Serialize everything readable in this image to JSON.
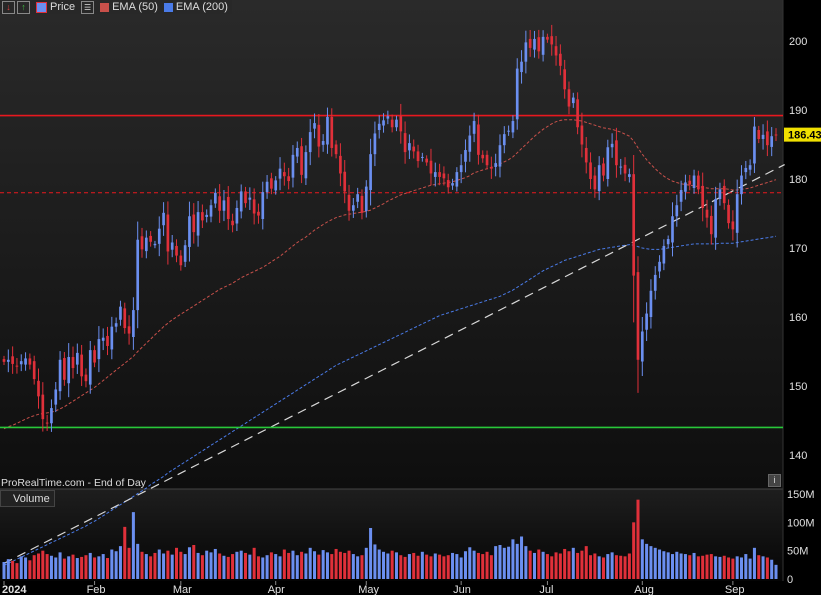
{
  "legend": {
    "price_label": "Price",
    "ema50_label": "EMA (50)",
    "ema200_label": "EMA (200)"
  },
  "volume_label": "Volume",
  "watermark": "ProRealTime.com - End of Day",
  "info_icon": "info-icon",
  "colors": {
    "background": "#000000",
    "up_candle": "#6b8ff0",
    "down_candle": "#e0303a",
    "ema50": "#c8504a",
    "ema200": "#4a7be8",
    "resistance": "#e8181f",
    "support": "#28c83a",
    "trendline": "#d8d8d8",
    "last_price_badge": "#f0e000"
  },
  "chart_data": [
    {
      "type": "candlestick",
      "title": "",
      "ylim": [
        135,
        205
      ],
      "y_ticks": [
        140,
        150,
        160,
        170,
        180,
        190,
        200
      ],
      "x_tick_labels": [
        "2024",
        "Feb",
        "Mar",
        "Apr",
        "May",
        "Jun",
        "Jul",
        "Aug",
        "Sep"
      ],
      "last_price": "186.43",
      "horizontal_levels": [
        {
          "name": "resistance",
          "y": 189.2,
          "style": "solid",
          "color": "#e8181f"
        },
        {
          "name": "mid-level",
          "y": 178.0,
          "style": "dashed",
          "color": "#e8181f"
        },
        {
          "name": "support",
          "y": 144.0,
          "style": "solid",
          "color": "#28c83a"
        }
      ],
      "trendline": {
        "style": "dashed",
        "from": [
          "2024-01-31",
          131.0
        ],
        "to": [
          "2024-09-12",
          180.5
        ]
      },
      "close": [
        153.5,
        153.8,
        153.2,
        152.9,
        153.6,
        154.0,
        153.1,
        151.0,
        148.5,
        145.2,
        144.6,
        146.8,
        149.5,
        153.8,
        150.9,
        154.2,
        152.6,
        154.8,
        151.4,
        150.7,
        155.2,
        153.4,
        156.8,
        157.0,
        155.8,
        158.6,
        159.1,
        161.5,
        158.4,
        157.6,
        161.0,
        171.2,
        169.8,
        171.5,
        170.9,
        170.6,
        172.8,
        175.1,
        169.5,
        170.8,
        168.9,
        167.5,
        170.4,
        174.6,
        172.3,
        175.2,
        174.0,
        174.8,
        176.2,
        178.0,
        175.4,
        176.9,
        174.2,
        173.3,
        175.8,
        178.2,
        176.5,
        177.3,
        175.0,
        174.7,
        178.1,
        179.6,
        178.6,
        179.8,
        181.5,
        180.4,
        179.7,
        183.5,
        184.5,
        180.6,
        183.9,
        186.8,
        188.1,
        184.7,
        185.5,
        189.0,
        184.5,
        183.6,
        180.8,
        178.2,
        175.4,
        176.2,
        177.8,
        175.1,
        178.9,
        183.6,
        186.6,
        188.0,
        188.5,
        189.1,
        187.5,
        188.6,
        186.9,
        183.9,
        185.2,
        184.0,
        182.6,
        183.2,
        182.4,
        180.8,
        181.0,
        180.3,
        180.1,
        178.8,
        179.4,
        181.0,
        182.0,
        184.2,
        186.3,
        188.4,
        183.5,
        183.0,
        182.0,
        181.5,
        182.3,
        184.9,
        186.5,
        187.0,
        188.4,
        196.0,
        197.0,
        199.8,
        199.0,
        200.3,
        198.5,
        200.6,
        200.2,
        199.5,
        197.9,
        196.4,
        193.0,
        190.5,
        191.8,
        187.5,
        185.0,
        182.4,
        180.0,
        178.5,
        182.0,
        180.5,
        184.6,
        185.1,
        182.0,
        181.8,
        180.8,
        180.7,
        166.0,
        153.8,
        157.9,
        160.5,
        163.8,
        166.1,
        168.0,
        170.3,
        171.3,
        174.6,
        176.2,
        178.4,
        179.5,
        179.2,
        180.5,
        178.5,
        175.8,
        174.4,
        172.0,
        177.1,
        178.5,
        176.5,
        173.6,
        172.7,
        177.8,
        180.5,
        181.6,
        182.0,
        187.6,
        185.8,
        186.4,
        184.9,
        186.2,
        186.43
      ],
      "ema50": [
        143.8,
        144.1,
        144.3,
        144.6,
        144.9,
        145.2,
        145.5,
        145.7,
        145.9,
        146.0,
        146.1,
        146.2,
        146.4,
        146.7,
        147.0,
        147.4,
        147.8,
        148.2,
        148.6,
        149.0,
        149.4,
        149.8,
        150.3,
        150.8,
        151.3,
        151.8,
        152.3,
        152.8,
        153.3,
        153.8,
        154.3,
        155.0,
        155.6,
        156.2,
        156.8,
        157.4,
        158.0,
        158.6,
        159.1,
        159.6,
        160.0,
        160.4,
        160.8,
        161.2,
        161.6,
        162.0,
        162.4,
        162.8,
        163.2,
        163.6,
        164.0,
        164.3,
        164.6,
        164.9,
        165.3,
        165.7,
        166.0,
        166.3,
        166.6,
        166.9,
        167.2,
        167.6,
        168.0,
        168.4,
        168.8,
        169.3,
        169.8,
        170.3,
        170.8,
        171.2,
        171.6,
        172.1,
        172.6,
        173.0,
        173.4,
        173.8,
        174.1,
        174.4,
        174.6,
        174.8,
        174.9,
        175.0,
        175.1,
        175.2,
        175.3,
        175.5,
        175.8,
        176.1,
        176.4,
        176.8,
        177.1,
        177.4,
        177.7,
        177.9,
        178.1,
        178.3,
        178.5,
        178.7,
        178.9,
        179.1,
        179.2,
        179.3,
        179.4,
        179.5,
        179.6,
        179.8,
        180.0,
        180.2,
        180.5,
        180.9,
        181.1,
        181.3,
        181.5,
        181.7,
        181.9,
        182.2,
        182.5,
        182.8,
        183.2,
        183.8,
        184.4,
        185.0,
        185.6,
        186.2,
        186.7,
        187.2,
        187.6,
        188.0,
        188.3,
        188.5,
        188.6,
        188.6,
        188.6,
        188.5,
        188.4,
        188.2,
        188.0,
        187.8,
        187.6,
        187.4,
        187.3,
        187.2,
        187.0,
        186.8,
        186.5,
        186.2,
        185.5,
        184.5,
        183.6,
        182.8,
        182.1,
        181.5,
        180.9,
        180.4,
        180.0,
        179.7,
        179.5,
        179.3,
        179.2,
        179.1,
        179.0,
        178.9,
        178.8,
        178.7,
        178.6,
        178.6,
        178.6,
        178.6,
        178.5,
        178.4,
        178.4,
        178.5,
        178.6,
        178.7,
        178.9,
        179.1,
        179.3,
        179.5,
        179.7,
        179.9
      ],
      "ema200": [
        124.0,
        124.3,
        124.6,
        124.9,
        125.2,
        125.5,
        125.8,
        126.1,
        126.4,
        126.7,
        127.0,
        127.3,
        127.6,
        127.9,
        128.2,
        128.5,
        128.8,
        129.1,
        129.4,
        129.7,
        130.1,
        130.4,
        130.8,
        131.2,
        131.6,
        132.0,
        132.4,
        132.8,
        133.2,
        133.6,
        134.0,
        134.4,
        134.8,
        135.2,
        135.7,
        136.1,
        136.5,
        136.9,
        137.4,
        137.8,
        138.2,
        138.6,
        139.0,
        139.4,
        139.8,
        140.2,
        140.6,
        141.0,
        141.4,
        141.8,
        142.2,
        142.6,
        143.0,
        143.4,
        143.8,
        144.2,
        144.6,
        145.0,
        145.4,
        145.8,
        146.2,
        146.6,
        147.0,
        147.4,
        147.8,
        148.2,
        148.6,
        149.0,
        149.4,
        149.8,
        150.2,
        150.6,
        151.0,
        151.4,
        151.8,
        152.2,
        152.6,
        153.0,
        153.3,
        153.6,
        153.9,
        154.2,
        154.5,
        154.8,
        155.1,
        155.4,
        155.7,
        156.0,
        156.3,
        156.6,
        156.9,
        157.2,
        157.5,
        157.8,
        158.1,
        158.4,
        158.7,
        159.0,
        159.3,
        159.6,
        159.9,
        160.2,
        160.4,
        160.6,
        160.8,
        161.0,
        161.2,
        161.4,
        161.6,
        161.8,
        162.0,
        162.2,
        162.4,
        162.6,
        162.8,
        163.0,
        163.3,
        163.6,
        163.9,
        164.3,
        164.7,
        165.1,
        165.5,
        165.9,
        166.3,
        166.7,
        167.0,
        167.3,
        167.6,
        167.9,
        168.2,
        168.4,
        168.6,
        168.8,
        169.0,
        169.2,
        169.4,
        169.6,
        169.8,
        169.9,
        170.0,
        170.1,
        170.2,
        170.3,
        170.4,
        170.5,
        170.4,
        170.2,
        170.0,
        169.9,
        169.8,
        169.8,
        169.8,
        169.9,
        170.0,
        170.1,
        170.2,
        170.3,
        170.4,
        170.5,
        170.6,
        170.6,
        170.6,
        170.6,
        170.6,
        170.6,
        170.7,
        170.7,
        170.7,
        170.7,
        170.8,
        170.9,
        171.0,
        171.1,
        171.2,
        171.3,
        171.4,
        171.5,
        171.6,
        171.7
      ]
    },
    {
      "type": "bar",
      "title": "Volume",
      "ylim": [
        0,
        150
      ],
      "y_tick_labels": [
        "150M",
        "100M",
        "50M",
        "0"
      ],
      "y_ticks": [
        150,
        100,
        50,
        0
      ],
      "values": [
        30,
        35,
        32,
        28,
        40,
        38,
        33,
        42,
        45,
        50,
        44,
        41,
        38,
        47,
        36,
        40,
        43,
        37,
        39,
        42,
        46,
        38,
        40,
        44,
        37,
        52,
        49,
        58,
        92,
        55,
        118,
        62,
        48,
        44,
        40,
        46,
        52,
        45,
        50,
        43,
        55,
        48,
        44,
        56,
        60,
        46,
        42,
        50,
        47,
        53,
        45,
        41,
        39,
        44,
        48,
        50,
        46,
        43,
        55,
        40,
        38,
        42,
        47,
        44,
        40,
        52,
        46,
        50,
        42,
        48,
        45,
        55,
        49,
        43,
        51,
        47,
        44,
        53,
        48,
        46,
        50,
        44,
        40,
        42,
        55,
        90,
        61,
        52,
        48,
        45,
        50,
        47,
        42,
        39,
        44,
        46,
        41,
        48,
        43,
        40,
        45,
        43,
        40,
        42,
        46,
        44,
        38,
        49,
        56,
        50,
        46,
        44,
        48,
        42,
        58,
        60,
        55,
        57,
        70,
        62,
        75,
        58,
        50,
        46,
        52,
        48,
        44,
        40,
        47,
        45,
        53,
        49,
        55,
        46,
        50,
        58,
        42,
        45,
        40,
        38,
        44,
        47,
        42,
        41,
        40,
        45,
        100,
        140,
        70,
        62,
        58,
        55,
        52,
        49,
        47,
        44,
        48,
        45,
        44,
        42,
        46,
        40,
        41,
        43,
        44,
        40,
        39,
        41,
        38,
        36,
        40,
        38,
        44,
        36,
        55,
        42,
        40,
        38,
        34,
        25
      ]
    }
  ]
}
